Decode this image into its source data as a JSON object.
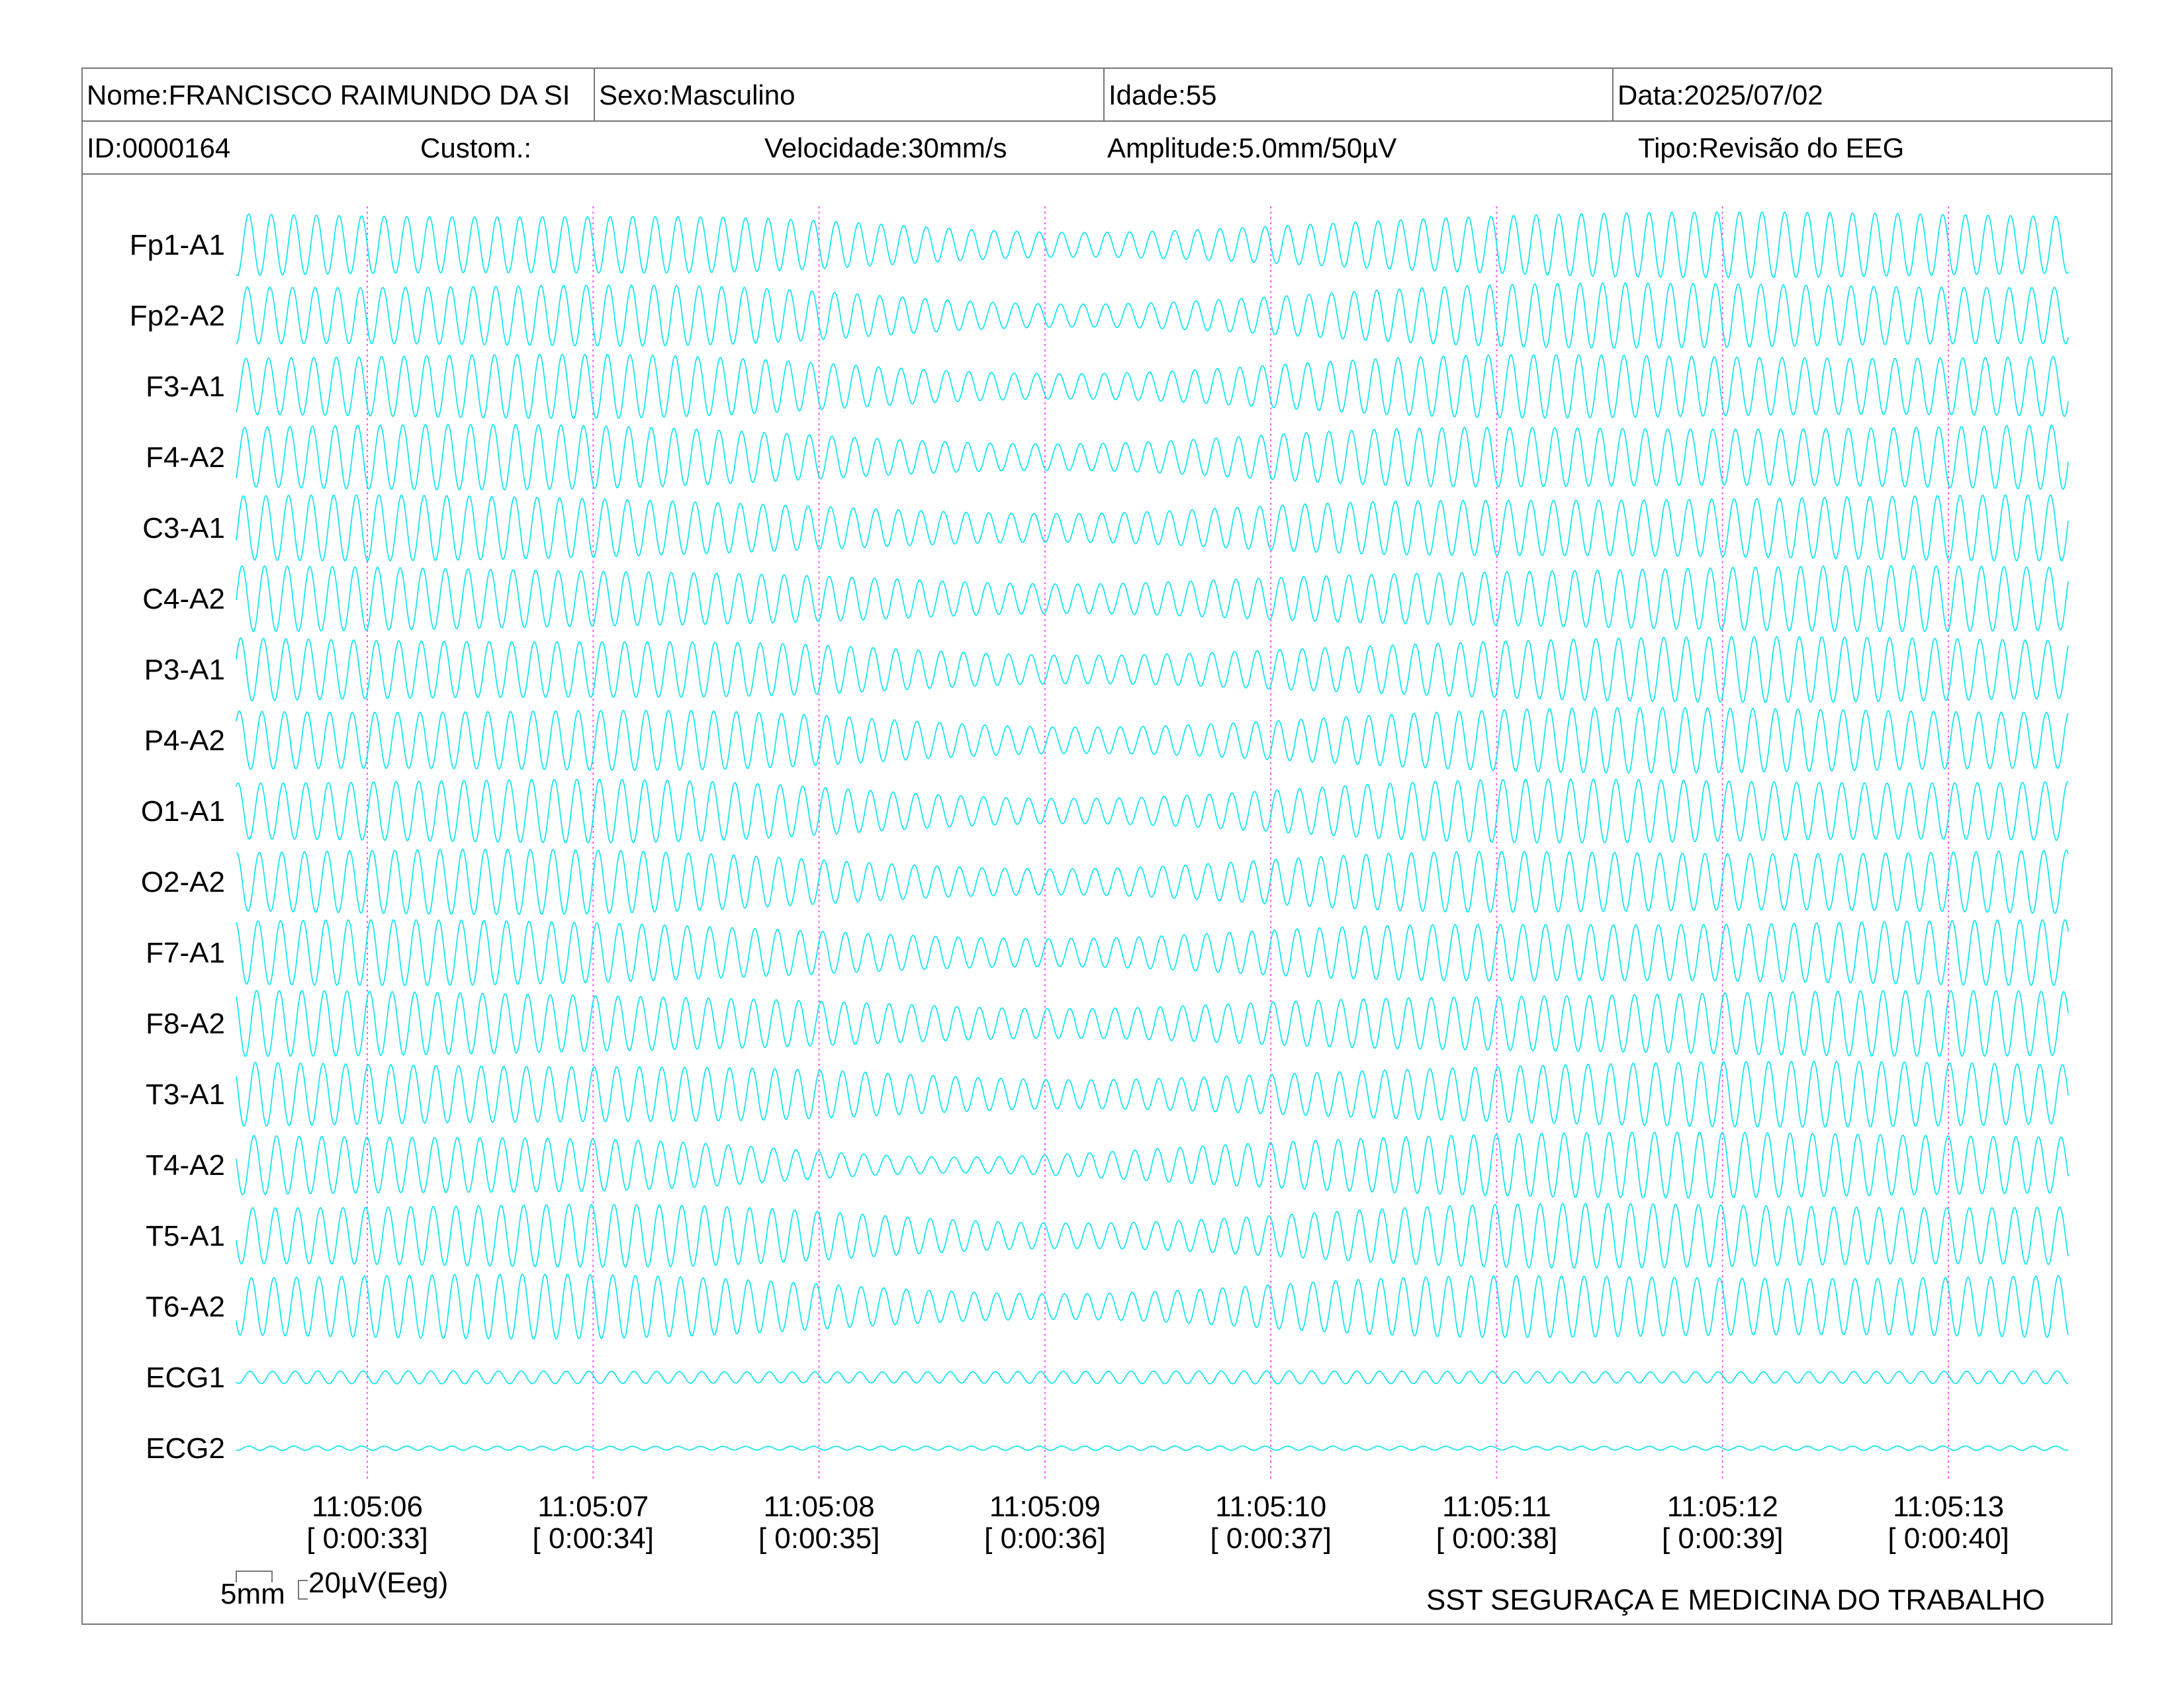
{
  "header": {
    "nome": "Nome:FRANCISCO RAIMUNDO DA SI",
    "sexo": "Sexo:Masculino",
    "idade": "Idade:55",
    "data": "Data:2025/07/02",
    "id": "ID:0000164",
    "custom": "Custom.:",
    "velocidade": "Velocidade:30mm/s",
    "amplitude": "Amplitude:5.0mm/50µV",
    "tipo": "Tipo:Revisão do EEG"
  },
  "footer": {
    "scale_x": "5mm",
    "scale_y": "20µV(Eeg)",
    "company": "SST SEGURAÇA E MEDICINA DO TRABALHO"
  },
  "colors": {
    "trace": "#00e5ef",
    "marker": "#ff55ff",
    "border": "#777777"
  },
  "chart_data": {
    "type": "line",
    "title": "",
    "channels": [
      "Fp1-A1",
      "Fp2-A2",
      "F3-A1",
      "F4-A2",
      "C3-A1",
      "C4-A2",
      "P3-A1",
      "P4-A2",
      "O1-A1",
      "O2-A2",
      "F7-A1",
      "F8-A2",
      "T3-A1",
      "T4-A2",
      "T5-A1",
      "T6-A2",
      "ECG1",
      "ECG2"
    ],
    "x_ticks": [
      {
        "time": "11:05:06",
        "elapsed": "[ 0:00:33]"
      },
      {
        "time": "11:05:07",
        "elapsed": "[ 0:00:34]"
      },
      {
        "time": "11:05:08",
        "elapsed": "[ 0:00:35]"
      },
      {
        "time": "11:05:09",
        "elapsed": "[ 0:00:36]"
      },
      {
        "time": "11:05:10",
        "elapsed": "[ 0:00:37]"
      },
      {
        "time": "11:05:11",
        "elapsed": "[ 0:00:38]"
      },
      {
        "time": "11:05:12",
        "elapsed": "[ 0:00:39]"
      },
      {
        "time": "11:05:13",
        "elapsed": "[ 0:00:40]"
      }
    ],
    "xlim_seconds": [
      5.42,
      13.53
    ],
    "frequency_hz_approx": 10,
    "grid": "vertical dotted second markers"
  }
}
